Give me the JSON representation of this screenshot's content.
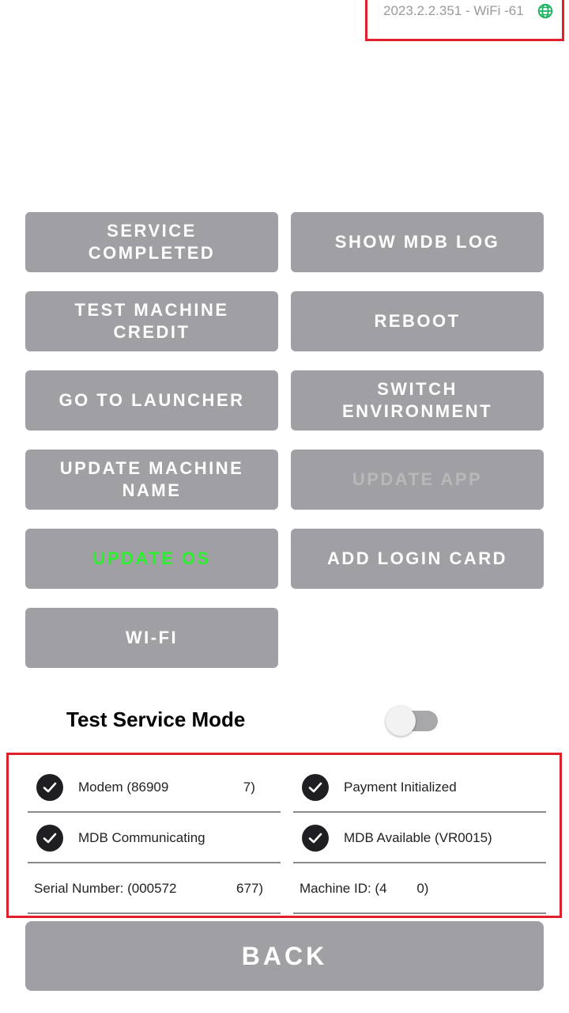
{
  "header": {
    "version_status": "2023.2.2.351 - WiFi -61",
    "globe_icon": "globe-icon",
    "globe_color": "#19b35f"
  },
  "buttons": {
    "service_completed": "SERVICE COMPLETED",
    "show_mdb_log": "SHOW MDB LOG",
    "test_machine_credit": "TEST MACHINE CREDIT",
    "reboot": "REBOOT",
    "go_to_launcher": "GO TO LAUNCHER",
    "switch_environment": "SWITCH ENVIRONMENT",
    "update_machine_name": "UPDATE MACHINE NAME",
    "update_app": "UPDATE APP",
    "update_os": "UPDATE OS",
    "add_login_card": "ADD LOGIN CARD",
    "wifi": "WI-FI",
    "back": "BACK"
  },
  "test_service_mode": {
    "label": "Test Service Mode",
    "enabled": false
  },
  "status": {
    "modem": "Modem (86909                    7)",
    "payment_initialized": "Payment Initialized",
    "mdb_communicating": "MDB Communicating",
    "mdb_available": "MDB Available (VR0015)",
    "serial_number": "Serial Number: (000572                677)",
    "machine_id": "Machine ID: (4        0)"
  },
  "colors": {
    "button_bg": "#a0a0a4",
    "highlight_border": "#e0202b",
    "update_os_text": "#28f02a",
    "disabled_text": "#b8b8bb"
  }
}
